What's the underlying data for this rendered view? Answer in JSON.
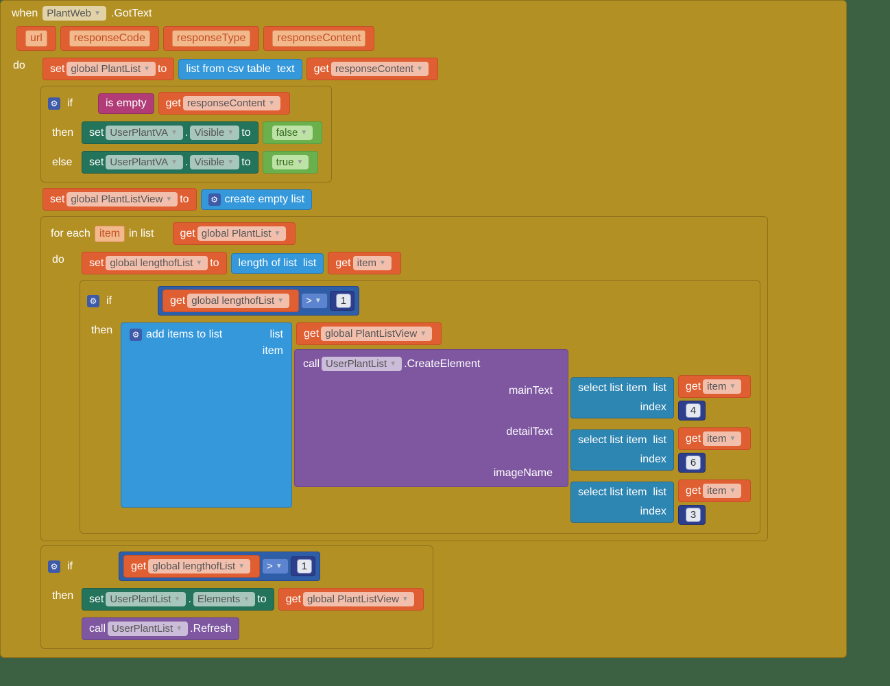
{
  "header": {
    "when": "when",
    "component": "PlantWeb",
    "event": ".GotText"
  },
  "params": [
    "url",
    "responseCode",
    "responseType",
    "responseContent"
  ],
  "kw": {
    "do": "do",
    "set": "set",
    "to": "to",
    "get": "get",
    "if": "if",
    "then": "then",
    "else": "else",
    "foreach": "for each",
    "item": "item",
    "inlist": "in list",
    "call": "call",
    "dot": "."
  },
  "vars": {
    "plantList": "global PlantList",
    "responseContent": "responseContent",
    "userPlantVA": "UserPlantVA",
    "visible": "Visible",
    "plantListView": "global PlantListView",
    "lengthofList": "global lengthofList",
    "itemVar": "item",
    "userPlantList": "UserPlantList",
    "elements": "Elements"
  },
  "ops": {
    "listFromCsv": "list from csv table",
    "text": "text",
    "isEmpty": "is empty",
    "createEmpty": "create empty list",
    "lengthOfList": "length of list",
    "list": "list",
    "gt": ">",
    "addItems": "add items to list",
    "selectListItem": "select list item",
    "index": "index"
  },
  "vals": {
    "false": "false",
    "true": "true",
    "one": "1",
    "four": "4",
    "six": "6",
    "three": "3"
  },
  "method": {
    "createElement": ".CreateElement",
    "refresh": ".Refresh"
  },
  "args": {
    "mainText": "mainText",
    "detailText": "detailText",
    "imageName": "imageName",
    "listArg": "list",
    "itemArg": "item"
  }
}
